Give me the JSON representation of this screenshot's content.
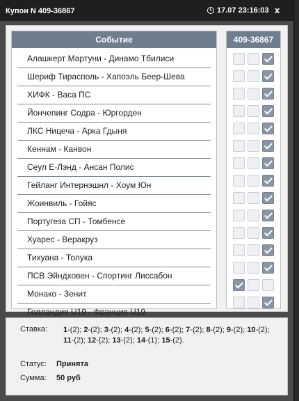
{
  "titlebar": {
    "title": "Купон N 409-36867",
    "datetime": "17.07 23:16:03",
    "close": "x"
  },
  "events_header": "Событие",
  "coupon_header": "409-36867",
  "events": [
    {
      "name": "Алашкерт Мартуни - Динамо Тбилиси",
      "checks": [
        false,
        false,
        true
      ]
    },
    {
      "name": "Шериф Тирасполь - Хапоэль Беер-Шева",
      "checks": [
        false,
        false,
        true
      ]
    },
    {
      "name": "ХИФК - Васа ПС",
      "checks": [
        false,
        false,
        true
      ]
    },
    {
      "name": "Йончепинг Содра - Юргорден",
      "checks": [
        false,
        false,
        true
      ]
    },
    {
      "name": "ЛКС Ницеча - Арка Гдыня",
      "checks": [
        false,
        false,
        true
      ]
    },
    {
      "name": "Кеннам - Канвон",
      "checks": [
        false,
        false,
        true
      ]
    },
    {
      "name": "Сеул Е-Лэнд - Ансан Полис",
      "checks": [
        false,
        false,
        true
      ]
    },
    {
      "name": "Гейланг Интернэшнл - Хоум Юн",
      "checks": [
        false,
        false,
        true
      ]
    },
    {
      "name": "Жоинвиль - Гойяс",
      "checks": [
        false,
        false,
        true
      ]
    },
    {
      "name": "Португеза СП - Томбенсе",
      "checks": [
        false,
        false,
        true
      ]
    },
    {
      "name": "Хуарес - Веракруз",
      "checks": [
        false,
        false,
        true
      ]
    },
    {
      "name": "Тихуана - Толука",
      "checks": [
        false,
        false,
        true
      ]
    },
    {
      "name": "ПСВ Эйндховен - Спортинг Лиссабон",
      "checks": [
        false,
        false,
        true
      ]
    },
    {
      "name": "Монако - Зенит",
      "checks": [
        true,
        false,
        false
      ]
    },
    {
      "name": "Голландия U19 - Франция U19",
      "checks": [
        false,
        false,
        true
      ]
    }
  ],
  "summary": {
    "bet_label": "Ставка:",
    "bets": [
      {
        "n": "1",
        "v": "-(2); "
      },
      {
        "n": "2",
        "v": "-(2); "
      },
      {
        "n": "3",
        "v": "-(2); "
      },
      {
        "n": "4",
        "v": "-(2); "
      },
      {
        "n": "5",
        "v": "-(2); "
      },
      {
        "n": "6",
        "v": "-(2); "
      },
      {
        "n": "7",
        "v": "-(2); "
      },
      {
        "n": "8",
        "v": "-(2); "
      },
      {
        "n": "9",
        "v": "-(2); "
      },
      {
        "n": "10",
        "v": "-(2); "
      },
      {
        "n": "11",
        "v": "-(2); "
      },
      {
        "n": "12",
        "v": "-(2); "
      },
      {
        "n": "13",
        "v": "-(2); "
      },
      {
        "n": "14",
        "v": "-(1); "
      },
      {
        "n": "15",
        "v": "-(2)."
      }
    ],
    "status_label": "Статус:",
    "status_value": "Принята",
    "sum_label": "Сумма:",
    "sum_value": "50 руб"
  }
}
